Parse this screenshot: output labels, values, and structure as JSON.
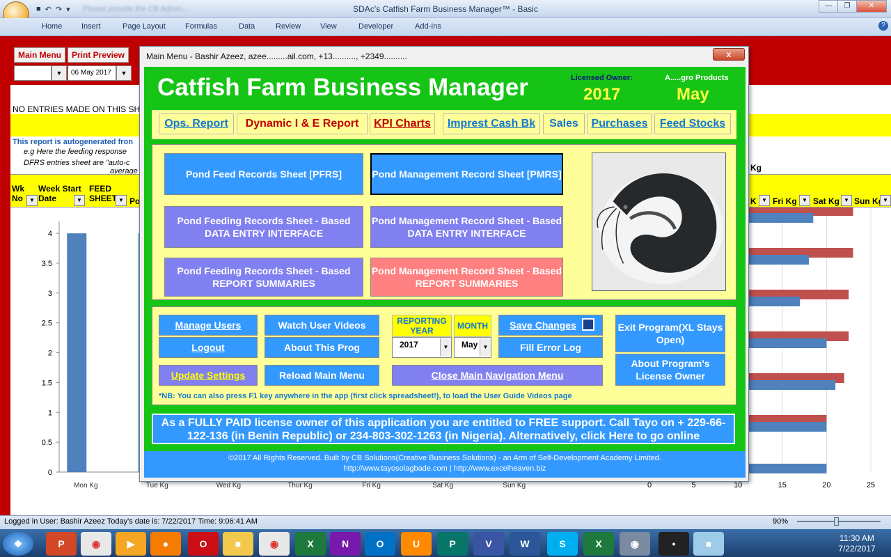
{
  "window": {
    "title": "SDAc's Catfish Farm Business Manager™ - Basic",
    "qat_hint": "Please provide the CB Admin..."
  },
  "ribbon": {
    "tabs": [
      "Home",
      "Insert",
      "Page Layout",
      "Formulas",
      "Data",
      "Review",
      "View",
      "Developer",
      "Add-Ins"
    ]
  },
  "sheet": {
    "main_menu": "Main Menu",
    "print_preview": "Print Preview",
    "date_value": "06 May 2017",
    "no_entries": "NO ENTRIES MADE ON THIS SHE",
    "autogen": "This report is autogenerated fron",
    "autogen2": "e.g Here the feeding response",
    "autogen3": "DFRS entries sheet are \"auto-c",
    "autogen4": "average",
    "headers": {
      "wk": "Wk No",
      "week_start": "Week Start Date",
      "feed_sheet": "FEED SHEET",
      "po": "Po",
      "kg_tail": "Kg",
      "k": "K",
      "fri": "Fri Kg",
      "sat": "Sat Kg",
      "sun": "Sun Kg"
    }
  },
  "chart_data": [
    {
      "type": "bar",
      "categories": [
        "Mon Kg",
        "Tue Kg",
        "Wed Kg",
        "Thur Kg",
        "Fri Kg",
        "Sat Kg",
        "Sun Kg"
      ],
      "values": [
        4,
        4,
        null,
        null,
        null,
        null,
        null
      ],
      "yticks": [
        "0",
        "0.5",
        "1",
        "1.5",
        "2",
        "2.5",
        "3",
        "3.5",
        "4"
      ],
      "ylim": [
        0,
        4.2
      ],
      "color": "#4f81bd"
    },
    {
      "type": "bar",
      "orientation": "horizontal",
      "xticks": [
        "0",
        "5",
        "10",
        "15",
        "20",
        "25"
      ],
      "xlim": [
        0,
        25
      ],
      "series": [
        {
          "color": "#c0504d",
          "values": [
            23,
            23,
            22.5,
            22.5,
            22,
            20
          ]
        },
        {
          "color": "#4f81bd",
          "values": [
            18.5,
            18,
            17,
            20,
            21,
            20,
            20
          ]
        }
      ]
    }
  ],
  "dialog": {
    "title": "Main Menu - Bashir Azeez, azee.........ail.com, +13.........., +2349..........",
    "close": "x",
    "app_title": "Catfish Farm Business Manager",
    "licensed_owner_label": "Licensed Owner:",
    "licensed_owner": "A.....gro Products",
    "year": "2017",
    "month": "May",
    "nav": [
      "Ops. Report",
      "Dynamic I & E Report",
      "KPI Charts",
      "Imprest Cash Bk",
      "Sales",
      "Purchases",
      "Feed Stocks"
    ],
    "pfrs": "Pond Feed Records Sheet [PFRS]",
    "pmrs": "Pond Management Record Sheet [PMRS]",
    "pfrs_entry": "Pond Feeding Records Sheet - Based DATA ENTRY INTERFACE",
    "pmrs_entry": "Pond Management Record Sheet  - Based DATA ENTRY INTERFACE",
    "pfrs_report": "Pond Feeding Records Sheet - Based REPORT SUMMARIES",
    "pmrs_report": "Pond Management Record Sheet  - Based REPORT SUMMARIES",
    "manage_users": "Manage Users",
    "watch_videos": "Watch User Videos",
    "logout": "Logout",
    "about_prog": "About This Prog",
    "update_settings": "Update Settings",
    "reload_menu": "Reload Main Menu",
    "reporting_year_label": "REPORTING YEAR",
    "month_label": "MONTH",
    "reporting_year_value": "2017",
    "month_value": "May",
    "save_changes": "Save Changes",
    "fill_error_log": "Fill Error Log",
    "close_nav": "Close Main Navigation Menu",
    "exit_program": "Exit Program(XL Stays Open)",
    "about_owner": "About Program's License Owner",
    "nb": "*NB: You can also press F1 key anywhere in the app (first click spreadsheet!), to load the User Guide Videos page",
    "support": "As a FULLY PAID license owner of this application you are entitled to FREE support. Call Tayo on + 229-66-122-136 (in Benin Republic) or 234-803-302-1263 (in Nigeria). Alternatively, click Here to go online",
    "footer1": "©2017 All Rights Reserved. Built by CB Solutions(Creative Business Solutions) - an Arm of Self-Development Academy Limited.",
    "footer2": "http://www.tayosolagbade.com | http://www.excelheaven.biz"
  },
  "status": {
    "text": "Logged in User: Bashir Azeez Today's date is: 7/22/2017 Time: 9:06:41 AM",
    "zoom": "90%"
  },
  "clock": {
    "time": "11:30 AM",
    "date": "7/22/2017"
  }
}
